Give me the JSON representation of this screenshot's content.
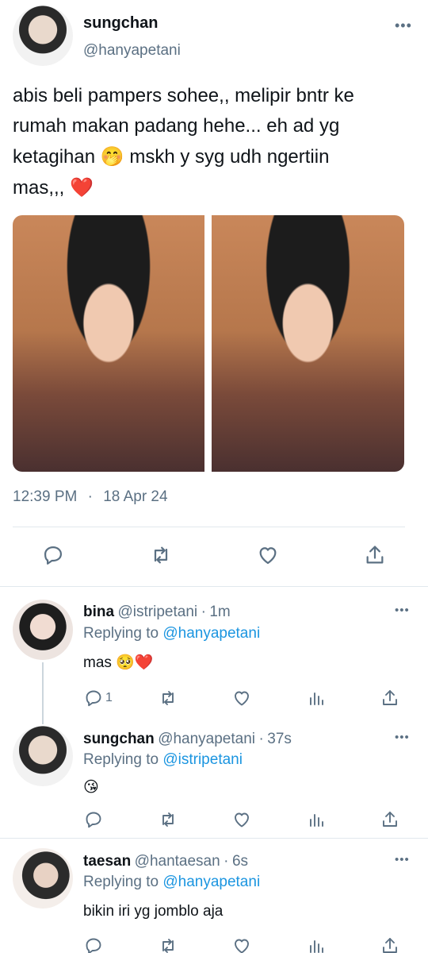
{
  "main_tweet": {
    "author_name": "sungchan",
    "author_handle": "@hanyapetani",
    "text_line1": "abis beli pampers sohee,, melipir bntr ke",
    "text_line2": "rumah makan padang hehe... eh ad yg",
    "text_line3_a": "ketagihan",
    "emoji_shush": "🤭",
    "text_line3_b": "mskh y syg udh ngertiin",
    "text_line4": "mas,,,",
    "emoji_heart": "❤️",
    "time": "12:39 PM",
    "dot": "·",
    "date": "18 Apr 24"
  },
  "more_label": "•••",
  "replies": [
    {
      "name": "bina",
      "handle": "@istripetani",
      "dot": "·",
      "age": "1m",
      "replying_prefix": "Replying to",
      "replying_to": "@hanyapetani",
      "text": "mas",
      "emojis": "🥺❤️",
      "reply_count": "1"
    },
    {
      "name": "sungchan",
      "handle": "@hanyapetani",
      "dot": "·",
      "age": "37s",
      "replying_prefix": "Replying to",
      "replying_to": "@istripetani",
      "emojis": "😘"
    },
    {
      "name": "taesan",
      "handle": "@hantaesan",
      "dot": "·",
      "age": "6s",
      "replying_prefix": "Replying to",
      "replying_to": "@hanyapetani",
      "text": "bikin iri yg jomblo aja"
    }
  ],
  "icons": {
    "reply": "reply-icon",
    "retweet": "retweet-icon",
    "like": "heart-icon",
    "share": "share-icon",
    "analytics": "analytics-icon",
    "more": "more-icon"
  },
  "colors": {
    "link": "#1b95e0",
    "secondary": "#5b7083",
    "divider": "#e1e8ed"
  }
}
